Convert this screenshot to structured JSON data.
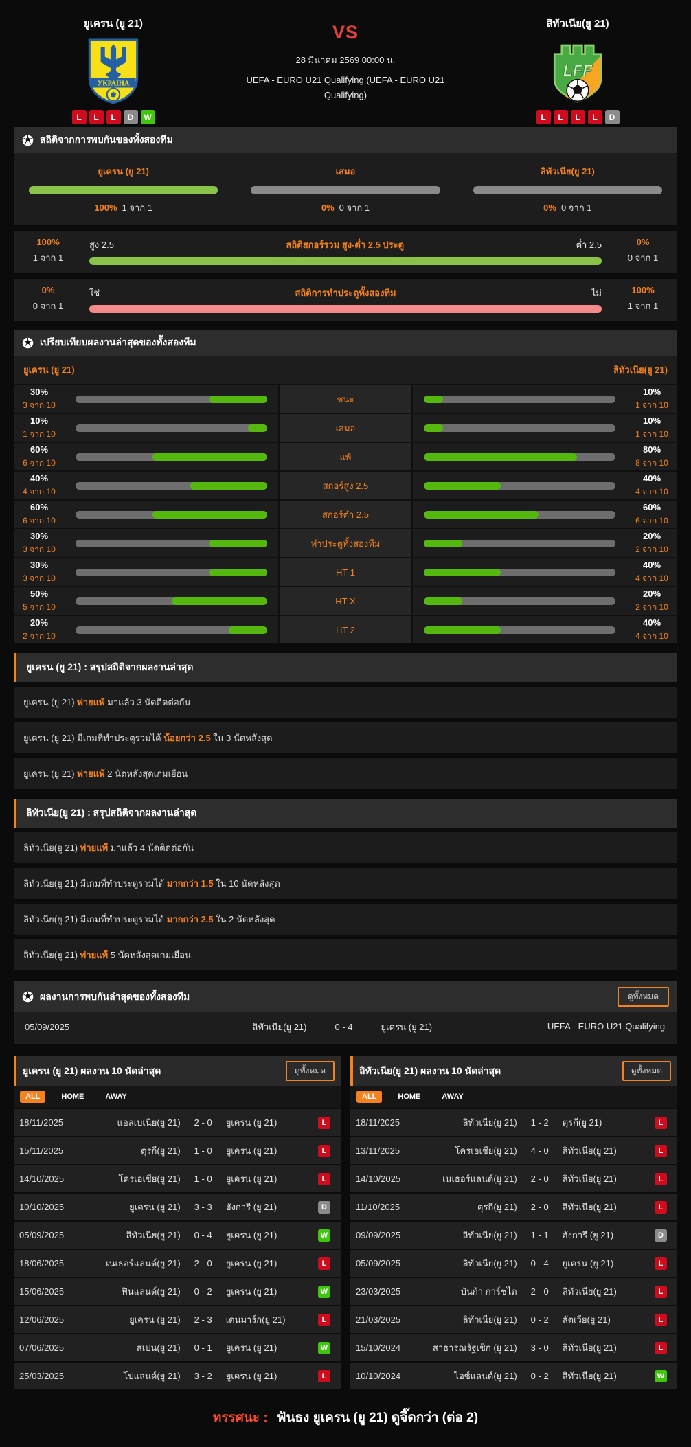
{
  "header": {
    "vs": "VS",
    "datetime": "28 มีนาคม 2569 00:00 น.",
    "competition": "UEFA - EURO U21 Qualifying (UEFA - EURO U21 Qualifying)",
    "home": {
      "name": "ยูเครน (ยู 21)",
      "crest_text": "УКРАЇНА",
      "form": [
        "L",
        "L",
        "L",
        "D",
        "W"
      ]
    },
    "away": {
      "name": "ลิทัวเนีย(ยู 21)",
      "crest_text": "LFF",
      "form": [
        "L",
        "L",
        "L",
        "L",
        "D"
      ]
    }
  },
  "colors": {
    "accent_orange": "#f5821f",
    "green_bar": "#8bc34a",
    "bright_green_bar": "#55b80e",
    "red_bar": "#f48a8a",
    "loss_badge": "#cf0b1e",
    "win_badge": "#3fc60d",
    "draw_badge": "#8b8b8b",
    "vs_red": "#e8413c"
  },
  "icons": {
    "section_icon": "soccer-ball-icon"
  },
  "h2h_stats": {
    "title": "สถิติจากการพบกันของทั้งสองทีม",
    "columns": [
      {
        "label": "ยูเครน (ยู 21)",
        "percent": "100%",
        "count": "1 จาก 1",
        "bar_percent": 100
      },
      {
        "label": "เสมอ",
        "percent": "0%",
        "count": "0 จาก 1",
        "bar_percent": 0
      },
      {
        "label": "ลิทัวเนีย(ยู 21)",
        "percent": "0%",
        "count": "0 จาก 1",
        "bar_percent": 0
      }
    ]
  },
  "ou_stats": {
    "title": "สถิติสกอร์รวม สูง-ต่ำ 2.5 ประตู",
    "left_label": "สูง 2.5",
    "right_label": "ต่ำ 2.5",
    "left_percent": "100%",
    "left_count": "1 จาก 1",
    "right_percent": "0%",
    "right_count": "0 จาก 1",
    "left_value": 100
  },
  "btts_stats": {
    "title": "สถิติการทำประตูทั้งสองทีม",
    "left_label": "ใช่",
    "right_label": "ไม่",
    "left_percent": "0%",
    "left_count": "0 จาก 1",
    "right_percent": "100%",
    "right_count": "1 จาก 1",
    "left_value": 0
  },
  "compare": {
    "title": "เปรียบเทียบผลงานล่าสุดของทั้งสองทีม",
    "home_label": "ยูเครน (ยู 21)",
    "away_label": "ลิทัวเนีย(ยู 21)",
    "rows": [
      {
        "label": "ชนะ",
        "home_percent": 30,
        "home_count": "3 จาก 10",
        "away_percent": 10,
        "away_count": "1 จาก 10"
      },
      {
        "label": "เสมอ",
        "home_percent": 10,
        "home_count": "1 จาก 10",
        "away_percent": 10,
        "away_count": "1 จาก 10"
      },
      {
        "label": "แพ้",
        "home_percent": 60,
        "home_count": "6 จาก 10",
        "away_percent": 80,
        "away_count": "8 จาก 10"
      },
      {
        "label": "สกอร์สูง 2.5",
        "home_percent": 40,
        "home_count": "4 จาก 10",
        "away_percent": 40,
        "away_count": "4 จาก 10"
      },
      {
        "label": "สกอร์ต่ำ 2.5",
        "home_percent": 60,
        "home_count": "6 จาก 10",
        "away_percent": 60,
        "away_count": "6 จาก 10"
      },
      {
        "label": "ทำประตูทั้งสองทีม",
        "home_percent": 30,
        "home_count": "3 จาก 10",
        "away_percent": 20,
        "away_count": "2 จาก 10"
      },
      {
        "label": "HT 1",
        "home_percent": 30,
        "home_count": "3 จาก 10",
        "away_percent": 40,
        "away_count": "4 จาก 10"
      },
      {
        "label": "HT X",
        "home_percent": 50,
        "home_count": "5 จาก 10",
        "away_percent": 20,
        "away_count": "2 จาก 10"
      },
      {
        "label": "HT 2",
        "home_percent": 20,
        "home_count": "2 จาก 10",
        "away_percent": 40,
        "away_count": "4 จาก 10"
      }
    ]
  },
  "home_summary": {
    "title": "ยูเครน (ยู 21) : สรุปสถิติจากผลงานล่าสุด",
    "rows": [
      {
        "pre": "ยูเครน (ยู 21) ",
        "highlight": "พ่ายแพ้",
        "post": " มาแล้ว 3 นัดติดต่อกัน"
      },
      {
        "pre": "ยูเครน (ยู 21) มีเกมที่ทำประตูรวมได้ ",
        "highlight": "น้อยกว่า 2.5",
        "post": " ใน 3 นัดหลังสุด"
      },
      {
        "pre": "ยูเครน (ยู 21) ",
        "highlight": "พ่ายแพ้",
        "post": " 2 นัดหลังสุดเกมเยือน"
      }
    ]
  },
  "away_summary": {
    "title": "ลิทัวเนีย(ยู 21) : สรุปสถิติจากผลงานล่าสุด",
    "rows": [
      {
        "pre": "ลิทัวเนีย(ยู 21) ",
        "highlight": "พ่ายแพ้",
        "post": " มาแล้ว 4 นัดติดต่อกัน"
      },
      {
        "pre": "ลิทัวเนีย(ยู 21) มีเกมที่ทำประตูรวมได้ ",
        "highlight": "มากกว่า 1.5",
        "post": " ใน 10 นัดหลังสุด"
      },
      {
        "pre": "ลิทัวเนีย(ยู 21) มีเกมที่ทำประตูรวมได้ ",
        "highlight": "มากกว่า 2.5",
        "post": " ใน 2 นัดหลังสุด"
      },
      {
        "pre": "ลิทัวเนีย(ยู 21) ",
        "highlight": "พ่ายแพ้",
        "post": " 5 นัดหลังสุดเกมเยือน"
      }
    ]
  },
  "h2h_recent": {
    "title": "ผลงานการพบกันล่าสุดของทั้งสองทีม",
    "view_all": "ดูทั้งหมด",
    "match": {
      "date": "05/09/2025",
      "home": "ลิทัวเนีย(ยู 21)",
      "score": "0 - 4",
      "away": "ยูเครน (ยู 21)",
      "competition": "UEFA - EURO U21 Qualifying"
    }
  },
  "home_last10": {
    "title": "ยูเครน (ยู 21) ผลงาน 10 นัดล่าสุด",
    "view_all": "ดูทั้งหมด",
    "tabs": [
      "ALL",
      "HOME",
      "AWAY"
    ],
    "active_tab": "ALL",
    "matches": [
      {
        "date": "18/11/2025",
        "home": "แอลเบเนีย(ยู 21)",
        "score": "2 - 0",
        "away": "ยูเครน (ยู 21)",
        "result": "L"
      },
      {
        "date": "15/11/2025",
        "home": "ตุรกี(ยู 21)",
        "score": "1 - 0",
        "away": "ยูเครน (ยู 21)",
        "result": "L"
      },
      {
        "date": "14/10/2025",
        "home": "โครเอเชีย(ยู 21)",
        "score": "1 - 0",
        "away": "ยูเครน (ยู 21)",
        "result": "L"
      },
      {
        "date": "10/10/2025",
        "home": "ยูเครน (ยู 21)",
        "score": "3 - 3",
        "away": "ฮังการี (ยู 21)",
        "result": "D"
      },
      {
        "date": "05/09/2025",
        "home": "ลิทัวเนีย(ยู 21)",
        "score": "0 - 4",
        "away": "ยูเครน (ยู 21)",
        "result": "W"
      },
      {
        "date": "18/06/2025",
        "home": "เนเธอร์แลนด์(ยู 21)",
        "score": "2 - 0",
        "away": "ยูเครน (ยู 21)",
        "result": "L"
      },
      {
        "date": "15/06/2025",
        "home": "ฟินแลนด์(ยู 21)",
        "score": "0 - 2",
        "away": "ยูเครน (ยู 21)",
        "result": "W"
      },
      {
        "date": "12/06/2025",
        "home": "ยูเครน (ยู 21)",
        "score": "2 - 3",
        "away": "เดนมาร์ก(ยู 21)",
        "result": "L"
      },
      {
        "date": "07/06/2025",
        "home": "สเปน(ยู 21)",
        "score": "0 - 1",
        "away": "ยูเครน (ยู 21)",
        "result": "W"
      },
      {
        "date": "25/03/2025",
        "home": "โปแลนด์(ยู 21)",
        "score": "3 - 2",
        "away": "ยูเครน (ยู 21)",
        "result": "L"
      }
    ]
  },
  "away_last10": {
    "title": "ลิทัวเนีย(ยู 21) ผลงาน 10 นัดล่าสุด",
    "view_all": "ดูทั้งหมด",
    "tabs": [
      "ALL",
      "HOME",
      "AWAY"
    ],
    "active_tab": "ALL",
    "matches": [
      {
        "date": "18/11/2025",
        "home": "ลิทัวเนีย(ยู 21)",
        "score": "1 - 2",
        "away": "ตุรกี(ยู 21)",
        "result": "L"
      },
      {
        "date": "13/11/2025",
        "home": "โครเอเชีย(ยู 21)",
        "score": "4 - 0",
        "away": "ลิทัวเนีย(ยู 21)",
        "result": "L"
      },
      {
        "date": "14/10/2025",
        "home": "เนเธอร์แลนด์(ยู 21)",
        "score": "2 - 0",
        "away": "ลิทัวเนีย(ยู 21)",
        "result": "L"
      },
      {
        "date": "11/10/2025",
        "home": "ตุรกี(ยู 21)",
        "score": "2 - 0",
        "away": "ลิทัวเนีย(ยู 21)",
        "result": "L"
      },
      {
        "date": "09/09/2025",
        "home": "ลิทัวเนีย(ยู 21)",
        "score": "1 - 1",
        "away": "ฮังการี (ยู 21)",
        "result": "D"
      },
      {
        "date": "05/09/2025",
        "home": "ลิทัวเนีย(ยู 21)",
        "score": "0 - 4",
        "away": "ยูเครน (ยู 21)",
        "result": "L"
      },
      {
        "date": "23/03/2025",
        "home": "บันก้า การ์ชได",
        "score": "2 - 0",
        "away": "ลิทัวเนีย(ยู 21)",
        "result": "L"
      },
      {
        "date": "21/03/2025",
        "home": "ลิทัวเนีย(ยู 21)",
        "score": "0 - 2",
        "away": "ลัตเวีย(ยู 21)",
        "result": "L"
      },
      {
        "date": "15/10/2024",
        "home": "สาธารณรัฐเช็ก (ยู 21)",
        "score": "3 - 0",
        "away": "ลิทัวเนีย(ยู 21)",
        "result": "L"
      },
      {
        "date": "10/10/2024",
        "home": "ไอซ์แลนด์(ยู 21)",
        "score": "0 - 2",
        "away": "ลิทัวเนีย(ยู 21)",
        "result": "W"
      }
    ]
  },
  "footer": {
    "label": "ทรรศนะ :",
    "text": "ฟันธง ยูเครน (ยู 21) ดูจี๊ดกว่า (ต่อ 2)"
  }
}
